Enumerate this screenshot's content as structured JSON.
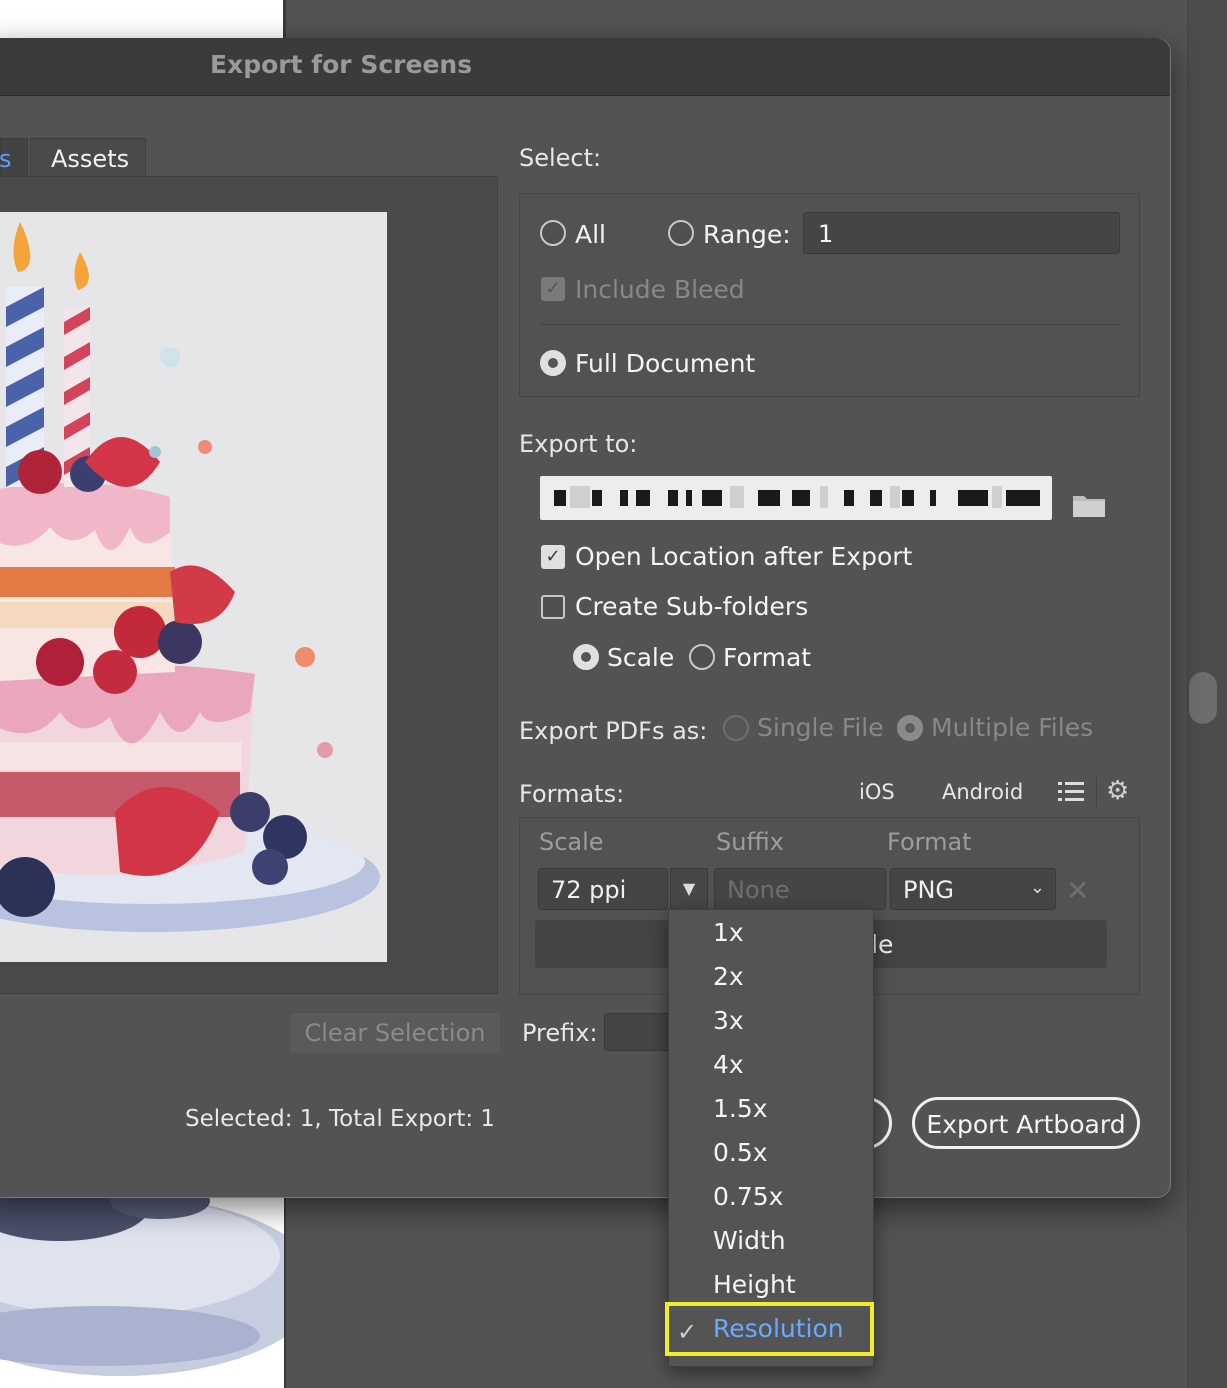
{
  "dialog": {
    "title": "Export for Screens",
    "tabs": [
      {
        "label": "s"
      },
      {
        "label": "Assets"
      }
    ],
    "clear_selection_label": "Clear Selection",
    "status_text": "Selected: 1, Total Export: 1"
  },
  "select": {
    "label": "Select:",
    "all_label": "All",
    "range_label": "Range:",
    "range_value": "1",
    "include_bleed_label": "Include Bleed",
    "full_document_label": "Full Document"
  },
  "export_to": {
    "label": "Export to:",
    "open_location_label": "Open Location after Export",
    "create_subfolders_label": "Create Sub-folders",
    "scale_label": "Scale",
    "format_label": "Format"
  },
  "export_pdfs": {
    "label": "Export PDFs as:",
    "single_file_label": "Single File",
    "multiple_files_label": "Multiple Files"
  },
  "formats": {
    "label": "Formats:",
    "ios_label": "iOS",
    "android_label": "Android",
    "columns": {
      "scale": "Scale",
      "suffix": "Suffix",
      "format": "Format"
    },
    "row": {
      "scale_value": "72 ppi",
      "suffix_placeholder": "None",
      "format_value": "PNG"
    },
    "add_scale_partial": "le"
  },
  "prefix": {
    "label": "Prefix:"
  },
  "export_button_label": "Export Artboard",
  "scale_dropdown": {
    "items": [
      "1x",
      "2x",
      "3x",
      "4x",
      "1.5x",
      "0.5x",
      "0.75x",
      "Width",
      "Height",
      "Resolution"
    ],
    "selected": "Resolution"
  },
  "colors": {
    "accent_selected": "#67aaff",
    "highlight": "#f2ec2e",
    "dialog_bg": "#535353"
  }
}
